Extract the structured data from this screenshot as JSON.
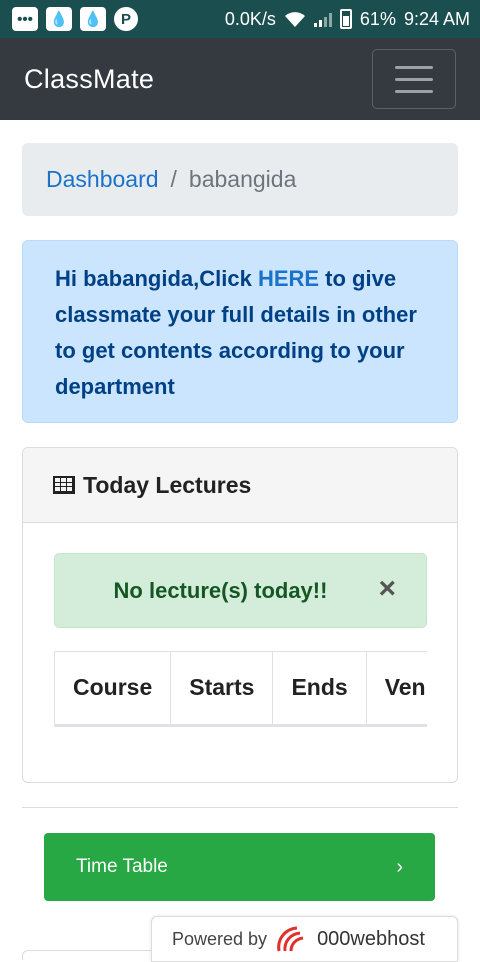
{
  "status_bar": {
    "network_speed": "0.0K/s",
    "battery": "61%",
    "time": "9:24 AM",
    "icons": [
      "messages-icon",
      "drop-icon",
      "drop-icon",
      "pinterest-icon",
      "wifi-icon",
      "signal-icon",
      "battery-icon"
    ]
  },
  "navbar": {
    "brand": "ClassMate",
    "toggler_icon": "hamburger-icon"
  },
  "breadcrumb": {
    "link": "Dashboard",
    "separator": "/",
    "current": "babangida"
  },
  "info_alert": {
    "prefix": "Hi babangida,Click ",
    "link": "HERE",
    "suffix": " to give classmate your full details in other to get contents according to your department"
  },
  "lectures_card": {
    "title": "Today Lectures",
    "icon": "table-icon",
    "empty_message": "No lecture(s) today!!",
    "close_symbol": "×",
    "columns": [
      "Course",
      "Starts",
      "Ends",
      "Venue"
    ]
  },
  "timetable_button": {
    "label": "Time Table",
    "chevron": "›"
  },
  "powered_by": {
    "label": "Powered by",
    "brand": "000webhost"
  },
  "colors": {
    "status_bar": "#1b4f4f",
    "navbar": "#343a40",
    "link": "#1a73c8",
    "info_bg": "#cce5ff",
    "info_text": "#004085",
    "success_bg": "#d4edda",
    "success_text": "#155724",
    "button_green": "#28a745"
  }
}
